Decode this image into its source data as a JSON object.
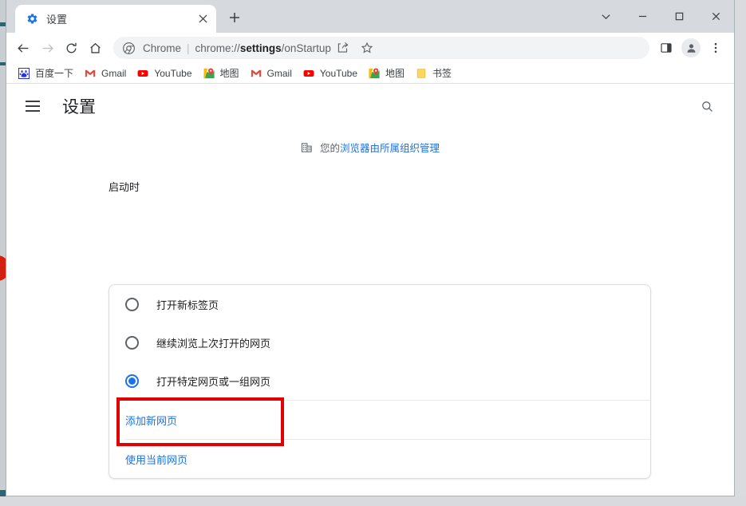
{
  "window": {
    "controls": [
      {
        "name": "tab-search",
        "glyph": "chevron-down"
      },
      {
        "name": "minimize",
        "glyph": "minimize"
      },
      {
        "name": "maximize",
        "glyph": "maximize"
      },
      {
        "name": "close",
        "glyph": "close"
      }
    ]
  },
  "tab": {
    "title": "设置",
    "favicon": "gear-icon",
    "close_label": "×",
    "new_tab_label": "+"
  },
  "toolbar": {
    "back": "back-arrow-icon",
    "forward": "forward-arrow-icon",
    "reload": "reload-icon",
    "home": "home-icon",
    "omnibox": {
      "icon": "chrome-logo-icon",
      "site_label": "Chrome",
      "separator": "|",
      "url_prefix": "chrome://",
      "url_bold": "settings",
      "url_suffix": "/onStartup",
      "full_url": "chrome://settings/onStartup"
    },
    "share": "share-icon",
    "bookmark": "star-icon",
    "side_panel": "side-panel-icon",
    "profile": "avatar-icon",
    "menu": "three-dot-menu-icon"
  },
  "bookmarks": [
    {
      "label": "百度一下",
      "icon": "baidu-icon"
    },
    {
      "label": "Gmail",
      "icon": "gmail-icon"
    },
    {
      "label": "YouTube",
      "icon": "youtube-icon"
    },
    {
      "label": "地图",
      "icon": "maps-icon"
    },
    {
      "label": "Gmail",
      "icon": "gmail-icon"
    },
    {
      "label": "YouTube",
      "icon": "youtube-icon"
    },
    {
      "label": "地图",
      "icon": "maps-icon"
    },
    {
      "label": "书签",
      "icon": "folder-icon"
    }
  ],
  "settings": {
    "menu_icon": "hamburger-icon",
    "title": "设置",
    "search_icon": "search-icon",
    "managed_banner": {
      "icon": "organization-building-icon",
      "static_text": "您的",
      "link_text": "浏览器由所属组织管理"
    },
    "section_title": "启动时",
    "options": [
      {
        "label": "打开新标签页",
        "checked": false
      },
      {
        "label": "继续浏览上次打开的网页",
        "checked": false
      },
      {
        "label": "打开特定网页或一组网页",
        "checked": true
      }
    ],
    "actions": [
      {
        "label": "添加新网页",
        "highlighted": true
      },
      {
        "label": "使用当前网页",
        "highlighted": false
      }
    ]
  },
  "annotation": {
    "color": "#e30000",
    "target": "添加新网页"
  }
}
